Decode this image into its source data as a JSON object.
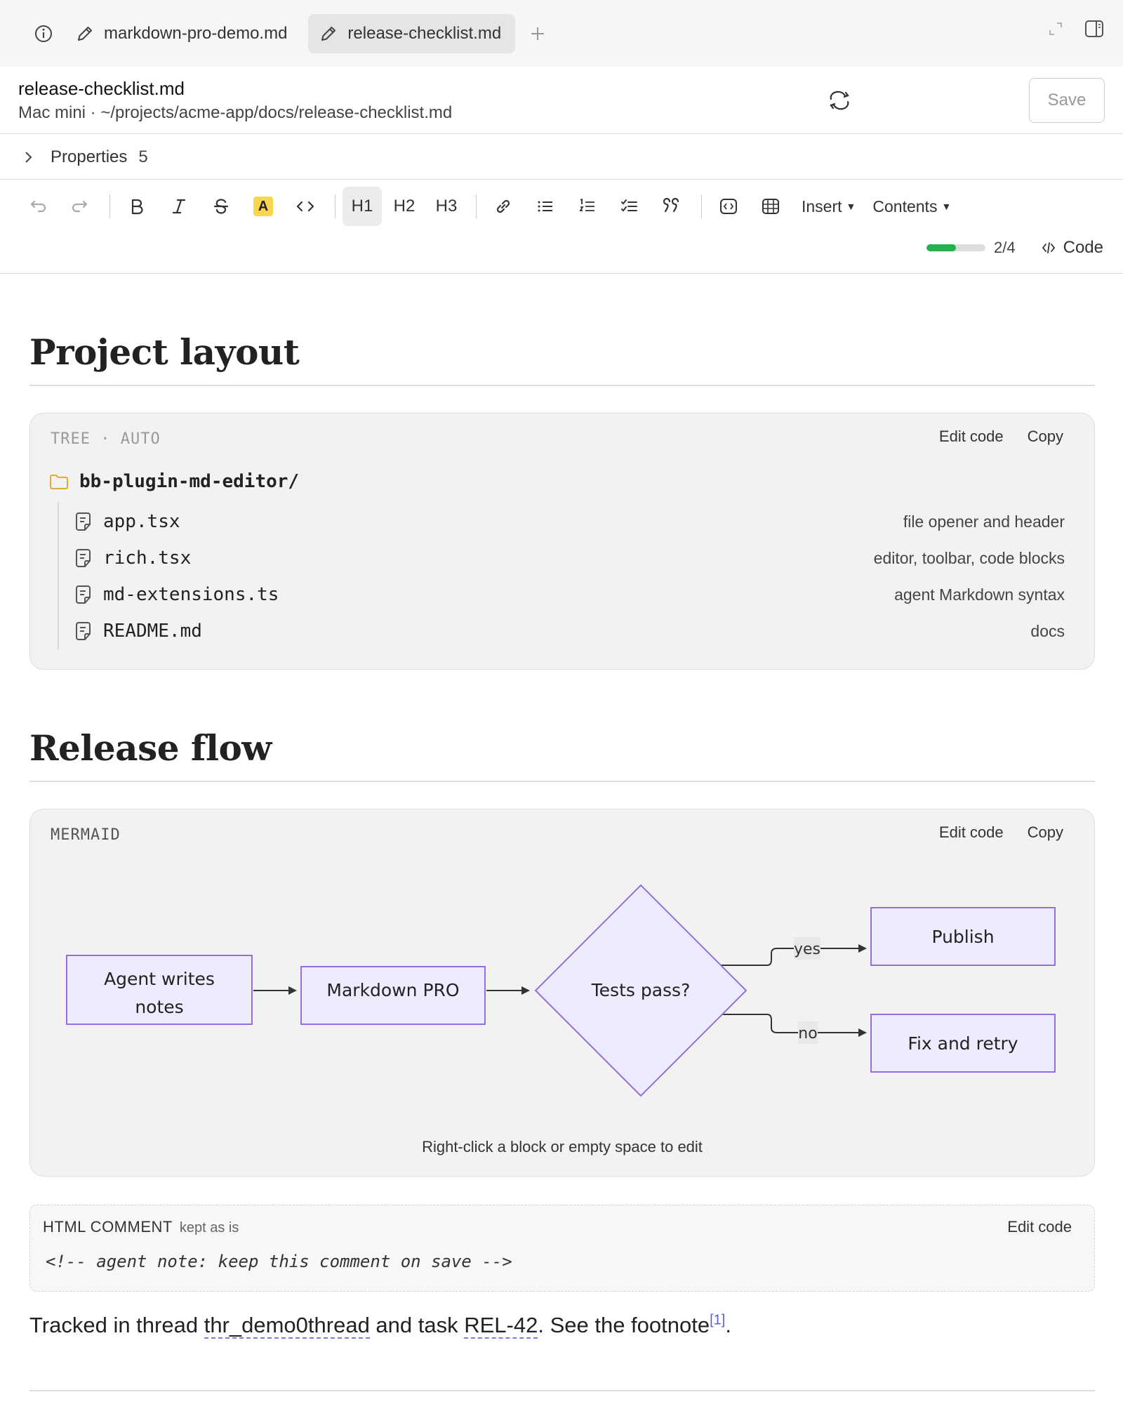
{
  "tabs": [
    {
      "label": "markdown-pro-demo.md",
      "active": false
    },
    {
      "label": "release-checklist.md",
      "active": true
    }
  ],
  "file": {
    "name": "release-checklist.md",
    "path": "Mac mini · ~/projects/acme-app/docs/release-checklist.md",
    "save_label": "Save"
  },
  "properties": {
    "label": "Properties",
    "count": "5"
  },
  "toolbar": {
    "h1": "H1",
    "h2": "H2",
    "h3": "H3",
    "highlight_letter": "A",
    "insert_label": "Insert",
    "contents_label": "Contents",
    "progress_text": "2/4",
    "progress_fraction": 0.5,
    "code_label": "Code"
  },
  "sections": [
    {
      "heading": "Project layout"
    },
    {
      "heading": "Release flow"
    }
  ],
  "tree_block": {
    "label": "TREE · AUTO",
    "edit_label": "Edit code",
    "copy_label": "Copy",
    "root": "bb-plugin-md-editor/",
    "files": [
      {
        "name": "app.tsx",
        "desc": "file opener and header"
      },
      {
        "name": "rich.tsx",
        "desc": "editor, toolbar, code blocks"
      },
      {
        "name": "md-extensions.ts",
        "desc": "agent Markdown syntax"
      },
      {
        "name": "README.md",
        "desc": "docs"
      }
    ]
  },
  "mermaid_block": {
    "label": "MERMAID",
    "edit_label": "Edit code",
    "copy_label": "Copy",
    "nodes": {
      "agent_line1": "Agent writes",
      "agent_line2": "notes",
      "md_pro": "Markdown PRO",
      "tests": "Tests pass?",
      "publish": "Publish",
      "fix": "Fix and retry"
    },
    "edges": {
      "yes": "yes",
      "no": "no"
    },
    "hint": "Right-click a block or empty space to edit"
  },
  "comment_block": {
    "label": "HTML COMMENT",
    "sub": "kept as is",
    "edit_label": "Edit code",
    "code": "<!-- agent note: keep this comment on save -->"
  },
  "paragraph": {
    "p1": "Tracked in thread ",
    "thread": "thr_demo0thread",
    "p2": " and task ",
    "task": "REL-42",
    "p3": ". See the footnote",
    "footnote": "[1]",
    "p4": "."
  },
  "colors": {
    "node_fill": "#ececfe",
    "node_stroke": "#9370db",
    "progress": "#22b14c",
    "highlight": "#f8d64e",
    "link_accent": "#5a5fcf"
  }
}
